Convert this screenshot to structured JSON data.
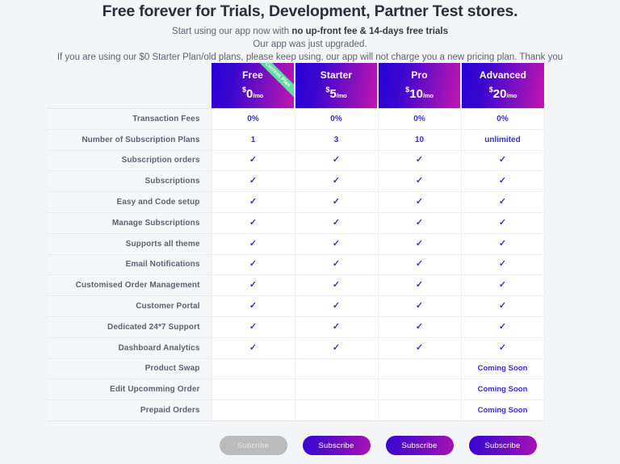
{
  "hero": {
    "title": "Free forever for Trials, Development, Partner Test stores.",
    "sub_prefix": "Start using our app now with ",
    "sub_bold": "no up-front fee & 14-days free trials",
    "line2": "Our app was just upgraded.",
    "line3": "If you are using our $0 Starter Plan/old plans, please keep using, our app will not charge you a new pricing plan. Thank you"
  },
  "ribbon": {
    "label": "Current Plan",
    "color": "#5fe0a0"
  },
  "colors": {
    "accent": "#3b2ae0",
    "gradient_start": "#2800d4",
    "gradient_end": "#c215b0",
    "page_bg": "#f4f5f7",
    "label_bg": "#f6f7f9",
    "disabled_btn": "#bcbcbc"
  },
  "plans": [
    {
      "name": "Free",
      "currency": "$",
      "amount": "0",
      "period": "/mo",
      "current": true,
      "button": "Subcribe",
      "button_disabled": true
    },
    {
      "name": "Starter",
      "currency": "$",
      "amount": "5",
      "period": "/mo",
      "current": false,
      "button": "Subscribe",
      "button_disabled": false
    },
    {
      "name": "Pro",
      "currency": "$",
      "amount": "10",
      "period": "/mo",
      "current": false,
      "button": "Subscribe",
      "button_disabled": false
    },
    {
      "name": "Advanced",
      "currency": "$",
      "amount": "20",
      "period": "/mo",
      "current": false,
      "button": "Subscribe",
      "button_disabled": false
    }
  ],
  "check_glyph": "✓",
  "rows": [
    {
      "label": "Transaction Fees",
      "type": "text",
      "values": [
        "0%",
        "0%",
        "0%",
        "0%"
      ]
    },
    {
      "label": "Number of Subscription Plans",
      "type": "text",
      "values": [
        "1",
        "3",
        "10",
        "unlimited"
      ]
    },
    {
      "label": "Subscription orders",
      "type": "check",
      "values": [
        true,
        true,
        true,
        true
      ]
    },
    {
      "label": "Subscriptions",
      "type": "check",
      "values": [
        true,
        true,
        true,
        true
      ]
    },
    {
      "label": "Easy and Code setup",
      "type": "check",
      "values": [
        true,
        true,
        true,
        true
      ]
    },
    {
      "label": "Manage Subscriptions",
      "type": "check",
      "values": [
        true,
        true,
        true,
        true
      ]
    },
    {
      "label": "Supports all theme",
      "type": "check",
      "values": [
        true,
        true,
        true,
        true
      ]
    },
    {
      "label": "Email Notifications",
      "type": "check",
      "values": [
        true,
        true,
        true,
        true
      ]
    },
    {
      "label": "Customised Order Management",
      "type": "check",
      "values": [
        true,
        true,
        true,
        true
      ]
    },
    {
      "label": "Customer Portal",
      "type": "check",
      "values": [
        true,
        true,
        true,
        true
      ]
    },
    {
      "label": "Dedicated 24*7 Support",
      "type": "check",
      "values": [
        true,
        true,
        true,
        true
      ]
    },
    {
      "label": "Dashboard Analytics",
      "type": "check",
      "values": [
        true,
        true,
        true,
        true
      ]
    },
    {
      "label": "Product Swap",
      "type": "text",
      "values": [
        "",
        "",
        "",
        "Coming Soon"
      ]
    },
    {
      "label": "Edit Upcomming Order",
      "type": "text",
      "values": [
        "",
        "",
        "",
        "Coming Soon"
      ]
    },
    {
      "label": "Prepaid Orders",
      "type": "text",
      "values": [
        "",
        "",
        "",
        "Coming Soon"
      ]
    }
  ]
}
